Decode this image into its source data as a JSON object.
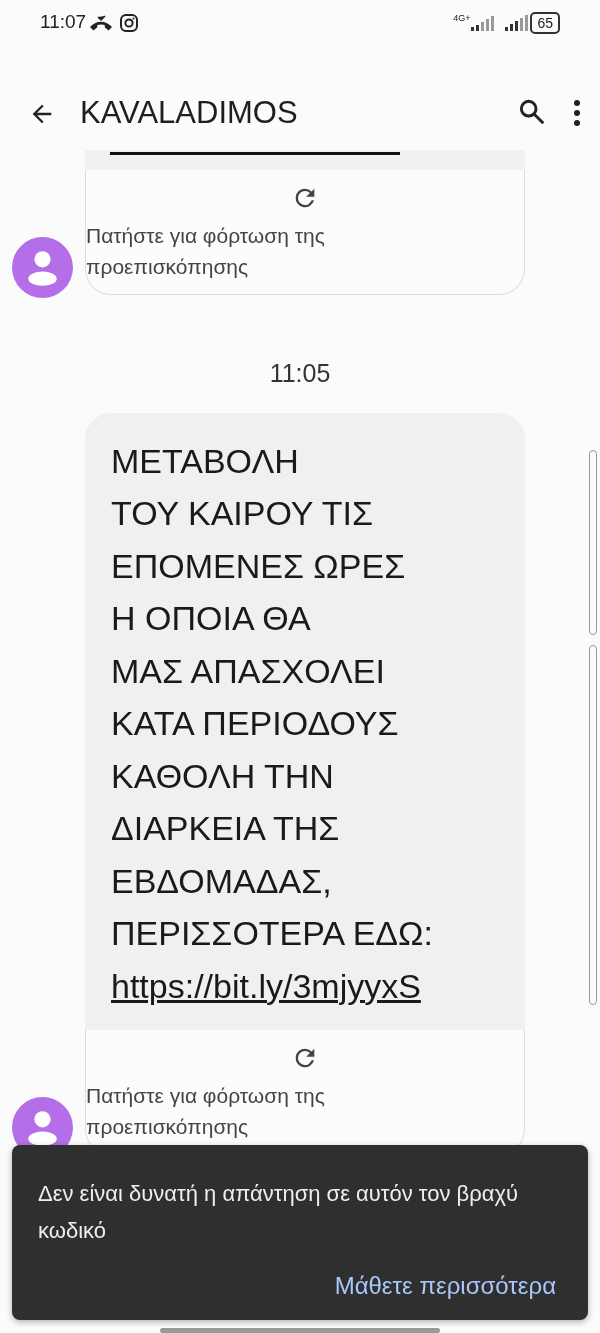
{
  "status_bar": {
    "time": "11:07",
    "network": "4G+",
    "battery": "65"
  },
  "app_bar": {
    "title": "KAVALADIMOS"
  },
  "messages": [
    {
      "kind": "preview_only",
      "preview": "Πατήστε για φόρτωση της προεπισκόπησης"
    },
    {
      "kind": "full",
      "timestamp": "11:05",
      "lines": [
        "ΜΕΤΑΒΟΛΗ",
        "ΤΟΥ ΚΑΙΡΟΥ ΤΙΣ",
        "ΕΠΟΜΕΝΕΣ ΩΡΕΣ",
        "Η ΟΠΟΙΑ ΘΑ",
        "ΜΑΣ ΑΠΑΣΧΟΛΕΙ",
        "ΚΑΤΑ ΠΕΡΙΟΔΟΥΣ",
        "ΚΑΘΟΛΗ ΤΗΝ",
        "ΔΙΑΡΚΕΙΑ ΤΗΣ",
        "ΕΒΔΟΜΑΔΑΣ,",
        "ΠΕΡΙΣΣΟΤΕΡΑ ΕΔΩ:"
      ],
      "link": "https://bit.ly/3mjyyxS",
      "preview": "Πατήστε για φόρτωση της προεπισκόπησης"
    }
  ],
  "snackbar": {
    "message": "Δεν είναι δυνατή η απάντηση σε αυτόν τον βραχύ κωδικό",
    "action": "Μάθετε περισσότερα"
  }
}
